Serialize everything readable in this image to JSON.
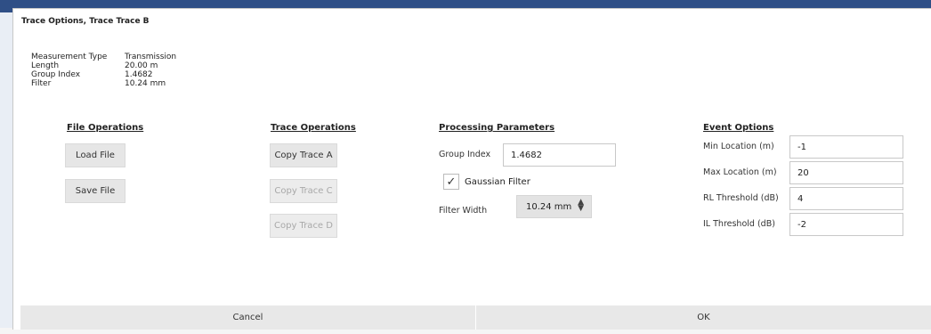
{
  "dialog": {
    "title": "Trace Options, Trace Trace B"
  },
  "info": [
    {
      "key": "Measurement Type",
      "value": "Transmission"
    },
    {
      "key": "Length",
      "value": "20.00 m"
    },
    {
      "key": "Group Index",
      "value": "1.4682"
    },
    {
      "key": "Filter",
      "value": "10.24 mm"
    }
  ],
  "file_ops": {
    "title": "File Operations",
    "load_label": "Load File",
    "save_label": "Save File"
  },
  "trace_ops": {
    "title": "Trace Operations",
    "copy_a": "Copy Trace A",
    "copy_c": "Copy Trace C",
    "copy_d": "Copy Trace D"
  },
  "processing": {
    "title": "Processing Parameters",
    "group_index_label": "Group Index",
    "group_index_value": "1.4682",
    "gaussian_label": "Gaussian Filter",
    "gaussian_checked": true,
    "filter_width_label": "Filter Width",
    "filter_width_value": "10.24 mm"
  },
  "events": {
    "title": "Event Options",
    "min_loc_label": "Min Location (m)",
    "min_loc_value": "-1",
    "max_loc_label": "Max Location (m)",
    "max_loc_value": "20",
    "rl_label": "RL Threshold (dB)",
    "rl_value": "4",
    "il_label": "IL Threshold (dB)",
    "il_value": "-2"
  },
  "footer": {
    "cancel_label": "Cancel",
    "ok_label": "OK"
  }
}
